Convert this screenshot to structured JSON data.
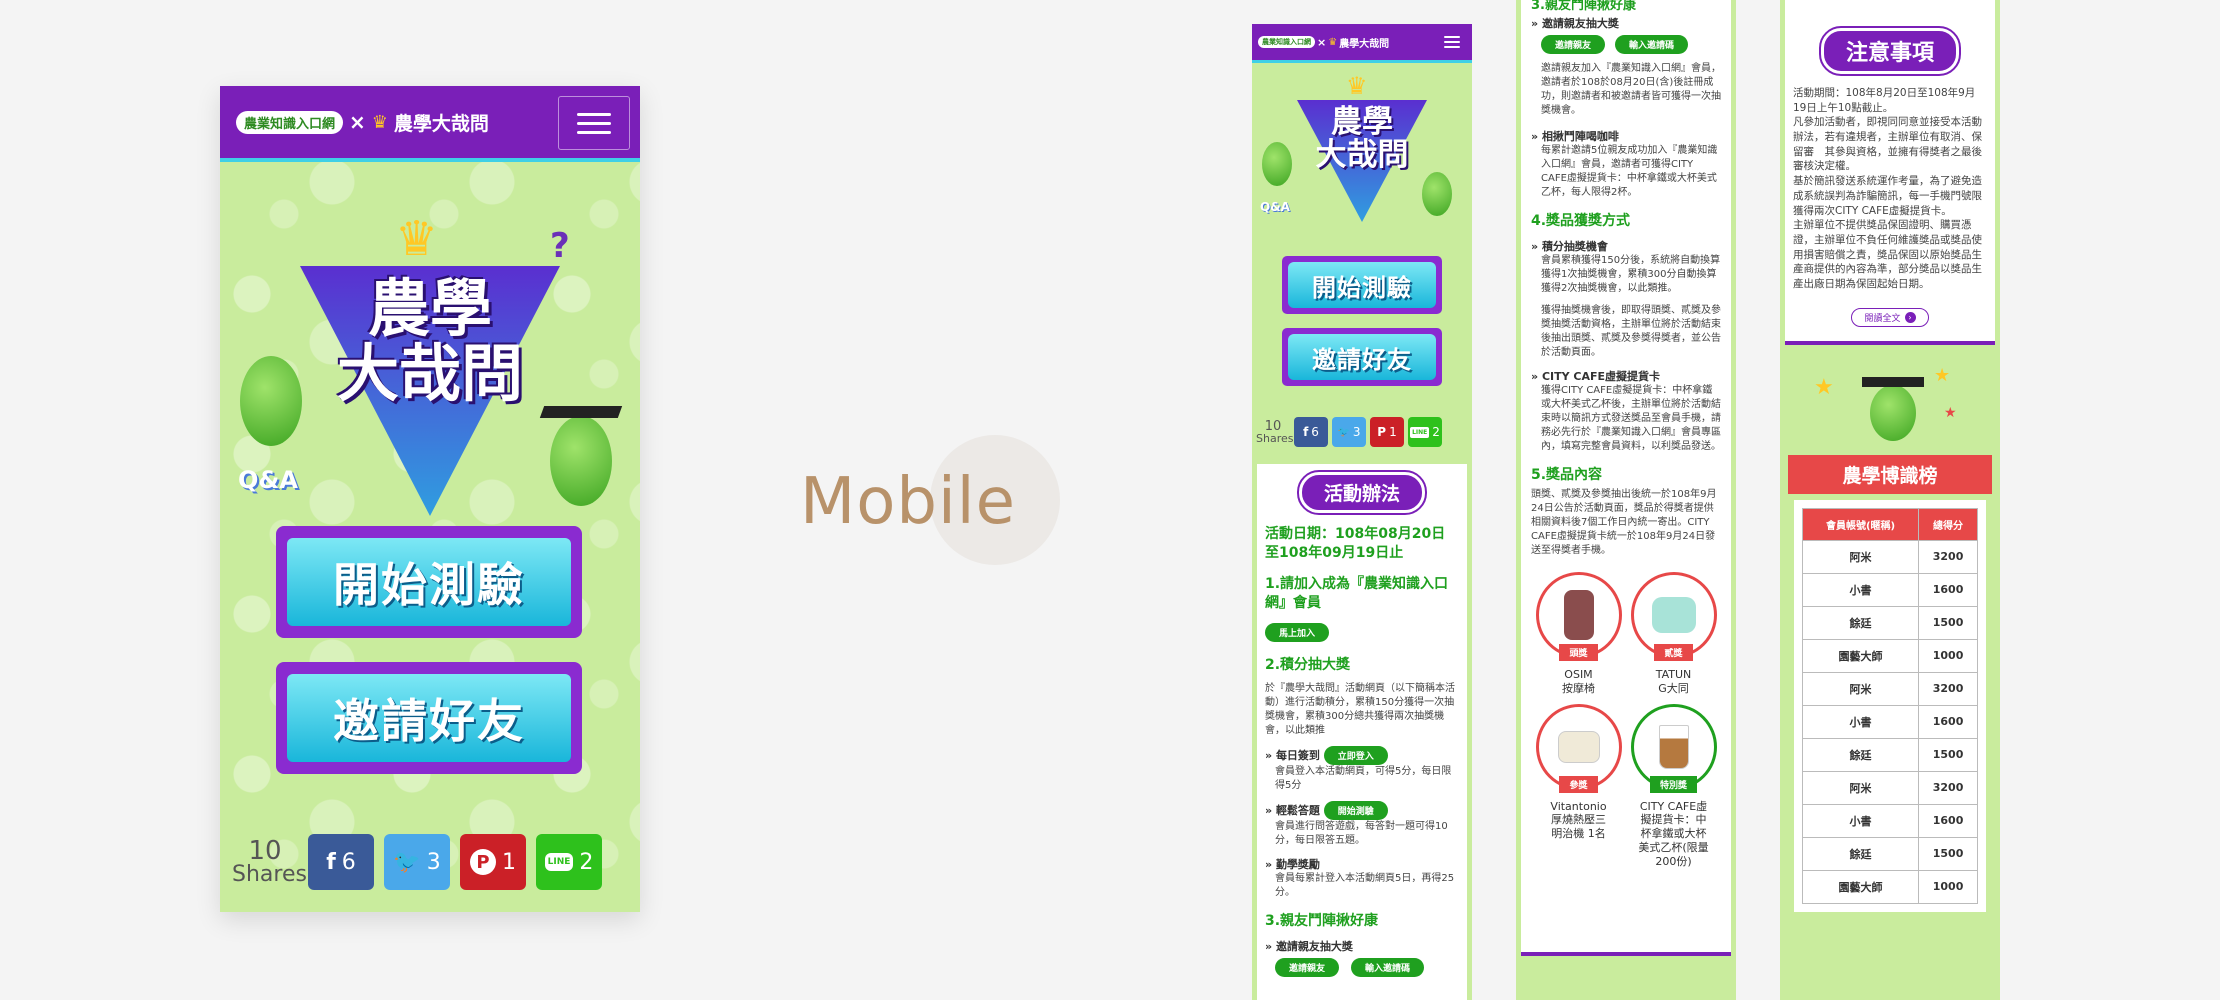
{
  "center_label": "Mobile",
  "brand": {
    "logo_left": "農業知識入口網",
    "logo_x": "×",
    "logo_right": "農學大哉問",
    "accent": "#7a1fb8",
    "cyan": "#3fd0e6",
    "green": "#1fa01f",
    "red": "#e74848"
  },
  "hero": {
    "title_line1": "農學",
    "title_line2": "大哉問",
    "qa_badge": "Q&A",
    "question_mark": "?"
  },
  "buttons": {
    "start_quiz": "開始測驗",
    "invite_friends": "邀請好友"
  },
  "shares": {
    "count": "10",
    "label": "Shares",
    "facebook": "6",
    "twitter": "3",
    "pinterest": "1",
    "line": "2"
  },
  "rules": {
    "heading": "活動辦法",
    "date": "活動日期：108年08月20日至108年09月19日止",
    "s1_title": "1.請加入成為『農業知識入口網』會員",
    "s1_btn": "馬上加入",
    "s2_title": "2.積分抽大獎",
    "s2_text": "於『農學大哉問』活動網頁（以下簡稱本活動）進行活動積分，累積150分獲得一次抽獎機會，累積300分總共獲得兩次抽獎機會，以此類推",
    "checkin_label": "每日簽到",
    "checkin_btn": "立即登入",
    "checkin_text": "會員登入本活動網頁，可得5分，每日限得5分",
    "quiz_label": "輕鬆答題",
    "quiz_btn": "開始測驗",
    "quiz_text": "會員進行問答遊戲，每答對一題可得10分，每日限答五題。",
    "bonus_label": "勤學獎勵",
    "bonus_text": "會員每累計登入本活動網頁5日，再得25分。",
    "s3_title": "3.親友鬥陣揪好康",
    "s3_sub": "邀請親友抽大獎",
    "invite_btn": "邀請親友",
    "code_btn": "輸入邀請碼"
  },
  "col3": {
    "s3_title": "3.親友鬥陣揪好康",
    "s3_sub": "邀請親友抽大獎",
    "invite_btn": "邀請親友",
    "code_btn": "輸入邀請碼",
    "invite_text": "邀請親友加入『農業知識入口網』會員，邀請者於108於08月20日(含)後註冊成功，則邀請者和被邀請者皆可獲得一次抽獎機會。",
    "coffee_label": "相揪鬥陣喝咖啡",
    "coffee_text": "每累計邀請5位親友成功加入『農業知識入口網』會員，邀請者可獲得CITY CAFE虛擬提貨卡：中杯拿鐵或大杯美式乙杯，每人限得2杯。",
    "s4_title": "4.獎品獲獎方式",
    "draw_label": "積分抽獎機會",
    "draw_text": "會員累積獲得150分後，系統將自動換算獲得1次抽獎機會，累積300分自動換算獲得2次抽獎機會，以此類推。",
    "draw_text2": "獲得抽獎機會後，即取得頭獎、貳獎及參獎抽獎活動資格，主辦單位將於活動結束後抽出頭獎、貳獎及參獎得獎者，並公告於活動頁面。",
    "card_label": "CITY CAFE虛擬提貨卡",
    "card_text": "獲得CITY CAFE虛擬提貨卡：中杯拿鐵或大杯美式乙杯後，主辦單位將於活動結束時以簡訊方式發送獎品至會員手機，請務必先行於『農業知識入口網』會員專區內，填寫完整會員資料，以利獎品發送。",
    "s5_title": "5.獎品內容",
    "s5_text": "頭獎、貳獎及參獎抽出後統一於108年9月24日公告於活動頁面，獎品於得獎者提供相關資料後7個工作日內統一寄出。CITY CAFE虛擬提貨卡統一於108年9月24日發送至得獎者手機。",
    "prizes": [
      {
        "tag": "頭獎",
        "name": "OSIM\n按摩椅"
      },
      {
        "tag": "貳獎",
        "name": "TATUN\nG大同"
      },
      {
        "tag": "參獎",
        "name": "Vitantonio\n厚燒熱壓三\n明治機 1名"
      },
      {
        "tag": "特別獎",
        "name": "CITY CAFE虛\n擬提貨卡：中\n杯拿鐵或大杯\n美式乙杯(限量\n200份)"
      }
    ]
  },
  "col4": {
    "notice_heading": "注意事項",
    "notice_text": "活動期間：108年8月20日至108年9月19日上午10點截止。\n凡參加活動者，即視同同意並接受本活動辦法，若有違規者，主辦單位有取消、保留審　其參與資格，並擁有得獎者之最後審核決定權。\n基於簡訊發送系統運作考量，為了避免造成系統誤判為詐騙簡訊，每一手機門號限獲得兩次CITY CAFE虛擬提貨卡。\n主辦單位不提供獎品保固證明、購買憑證，主辦單位不負任何維護獎品或獎品使用損害賠償之責，獎品保固以原始獎品生產商提供的內容為準，部分獎品以獎品生產出廠日期為保固起始日期。",
    "read_more": "閱讀全文",
    "ranking_title": "農學博識榜",
    "col_account": "會員帳號(暱稱)",
    "col_score": "總得分",
    "rows": [
      {
        "name": "阿米",
        "score": "3200"
      },
      {
        "name": "小書",
        "score": "1600"
      },
      {
        "name": "餘廷",
        "score": "1500"
      },
      {
        "name": "園藝大師",
        "score": "1000"
      },
      {
        "name": "阿米",
        "score": "3200"
      },
      {
        "name": "小書",
        "score": "1600"
      },
      {
        "name": "餘廷",
        "score": "1500"
      },
      {
        "name": "阿米",
        "score": "3200"
      },
      {
        "name": "小書",
        "score": "1600"
      },
      {
        "name": "餘廷",
        "score": "1500"
      },
      {
        "name": "園藝大師",
        "score": "1000"
      }
    ]
  }
}
